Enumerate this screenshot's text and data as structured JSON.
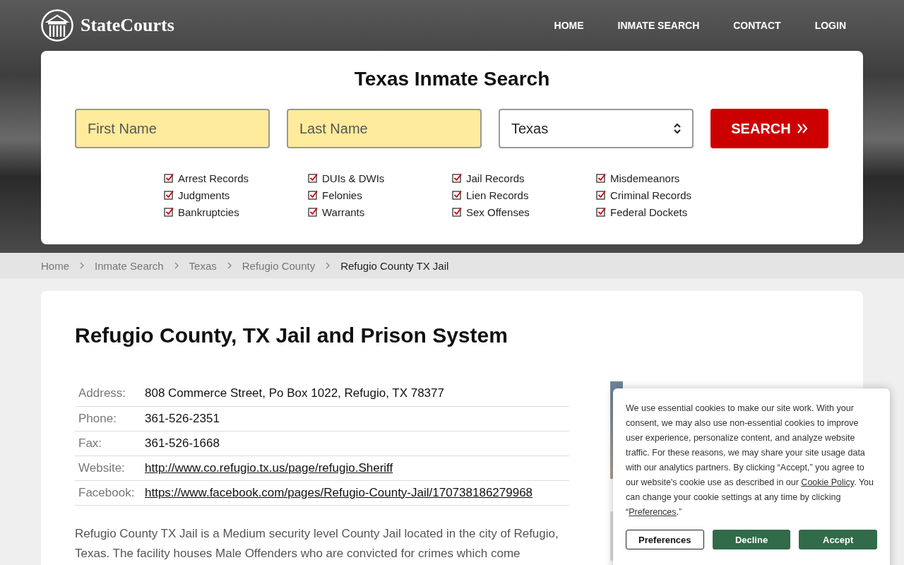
{
  "brand": {
    "name": "StateCourts"
  },
  "nav": [
    "HOME",
    "INMATE SEARCH",
    "CONTACT",
    "LOGIN"
  ],
  "search": {
    "title": "Texas Inmate Search",
    "first_name": {
      "placeholder": "First Name"
    },
    "last_name": {
      "placeholder": "Last Name"
    },
    "state": {
      "value": "Texas"
    },
    "button": "SEARCH",
    "record_types": [
      {
        "label": "Arrest Records",
        "checked": true
      },
      {
        "label": "DUIs & DWIs",
        "checked": true
      },
      {
        "label": "Jail Records",
        "checked": true
      },
      {
        "label": "Misdemeanors",
        "checked": true
      },
      {
        "label": "Judgments",
        "checked": true
      },
      {
        "label": "Felonies",
        "checked": true
      },
      {
        "label": "Lien Records",
        "checked": true
      },
      {
        "label": "Criminal Records",
        "checked": true
      },
      {
        "label": "Bankruptcies",
        "checked": true
      },
      {
        "label": "Warrants",
        "checked": true
      },
      {
        "label": "Sex Offenses",
        "checked": true
      },
      {
        "label": "Federal Dockets",
        "checked": true
      }
    ]
  },
  "breadcrumb": [
    {
      "label": "Home",
      "current": false
    },
    {
      "label": "Inmate Search",
      "current": false
    },
    {
      "label": "Texas",
      "current": false
    },
    {
      "label": "Refugio County",
      "current": false
    },
    {
      "label": "Refugio County TX Jail",
      "current": true
    }
  ],
  "page_title": "Refugio County, TX Jail and Prison System",
  "details": [
    {
      "label": "Address:",
      "value": "808 Commerce Street, Po Box 1022, Refugio, TX 78377",
      "kind": "text"
    },
    {
      "label": "Phone:",
      "value": "361-526-2351",
      "kind": "text"
    },
    {
      "label": "Fax:",
      "value": "361-526-1668",
      "kind": "text"
    },
    {
      "label": "Website:",
      "value": "http://www.co.refugio.tx.us/page/refugio.Sheriff",
      "kind": "link"
    },
    {
      "label": "Facebook:",
      "value": "https://www.facebook.com/pages/Refugio-County-Jail/170738186279968",
      "kind": "link"
    }
  ],
  "description": "Refugio County TX Jail is a Medium security level County Jail located in the city of Refugio, Texas. The facility houses Male Offenders who are convicted for crimes which come",
  "cookie_banner": {
    "text_before": "We use essential cookies to make our site work. With your consent, we may also use non-essential cookies to improve user experience, personalize content, and analyze website traffic. For these reasons, we may share your site usage data with our analytics partners. By clicking “Accept,” you agree to our website's cookie use as described in our ",
    "policy_link": "Cookie Policy",
    "text_middle": ". You can change your cookie settings at any time by clicking “",
    "preferences_link": "Preferences",
    "text_after": ".”",
    "buttons": [
      {
        "label": "Preferences",
        "kind": "outline"
      },
      {
        "label": "Decline",
        "kind": "filled"
      },
      {
        "label": "Accept",
        "kind": "filled"
      }
    ]
  }
}
